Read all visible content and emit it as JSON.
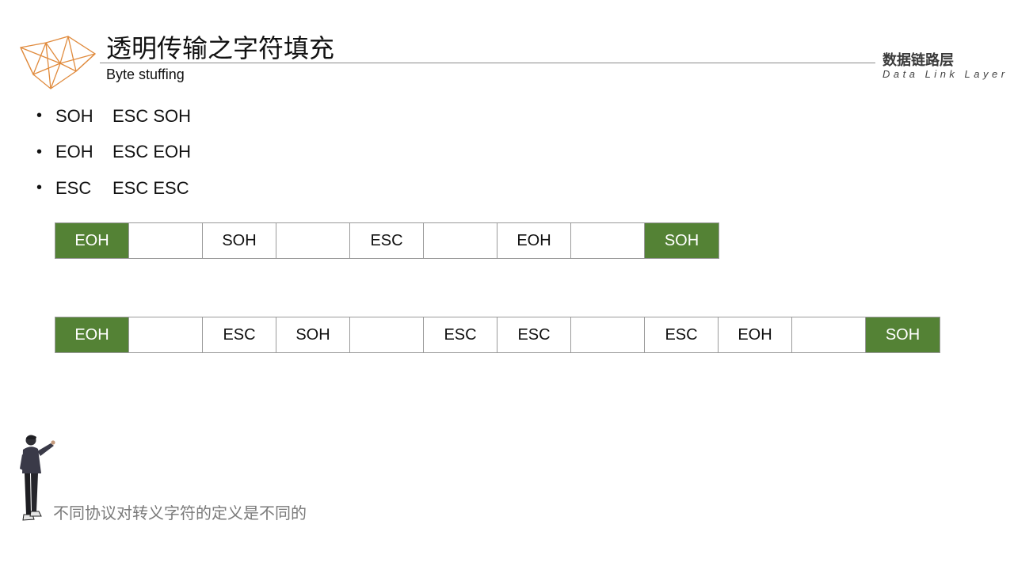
{
  "header": {
    "title": "透明传输之字符填充",
    "subtitle": "Byte stuffing",
    "section_title": "数据链路层",
    "section_subtitle": "Data Link Layer"
  },
  "rules": [
    {
      "char": "SOH",
      "escaped": "ESC SOH"
    },
    {
      "char": "EOH",
      "escaped": "ESC EOH"
    },
    {
      "char": "ESC",
      "escaped": "ESC ESC"
    }
  ],
  "frame_original": {
    "cells": [
      {
        "text": "EOH",
        "flag": true
      },
      {
        "text": "",
        "flag": false
      },
      {
        "text": "SOH",
        "flag": false
      },
      {
        "text": "",
        "flag": false
      },
      {
        "text": "ESC",
        "flag": false
      },
      {
        "text": "",
        "flag": false
      },
      {
        "text": "EOH",
        "flag": false
      },
      {
        "text": "",
        "flag": false
      },
      {
        "text": "SOH",
        "flag": true
      }
    ]
  },
  "frame_stuffed": {
    "cells": [
      {
        "text": "EOH",
        "flag": true
      },
      {
        "text": "",
        "flag": false
      },
      {
        "text": "ESC",
        "flag": false
      },
      {
        "text": "SOH",
        "flag": false
      },
      {
        "text": "",
        "flag": false
      },
      {
        "text": "ESC",
        "flag": false
      },
      {
        "text": "ESC",
        "flag": false
      },
      {
        "text": "",
        "flag": false
      },
      {
        "text": "ESC",
        "flag": false
      },
      {
        "text": "EOH",
        "flag": false
      },
      {
        "text": "",
        "flag": false
      },
      {
        "text": "SOH",
        "flag": true
      }
    ]
  },
  "note": "不同协议对转义字符的定义是不同的",
  "colors": {
    "flag": "#548235",
    "accent": "#e08a3c"
  }
}
